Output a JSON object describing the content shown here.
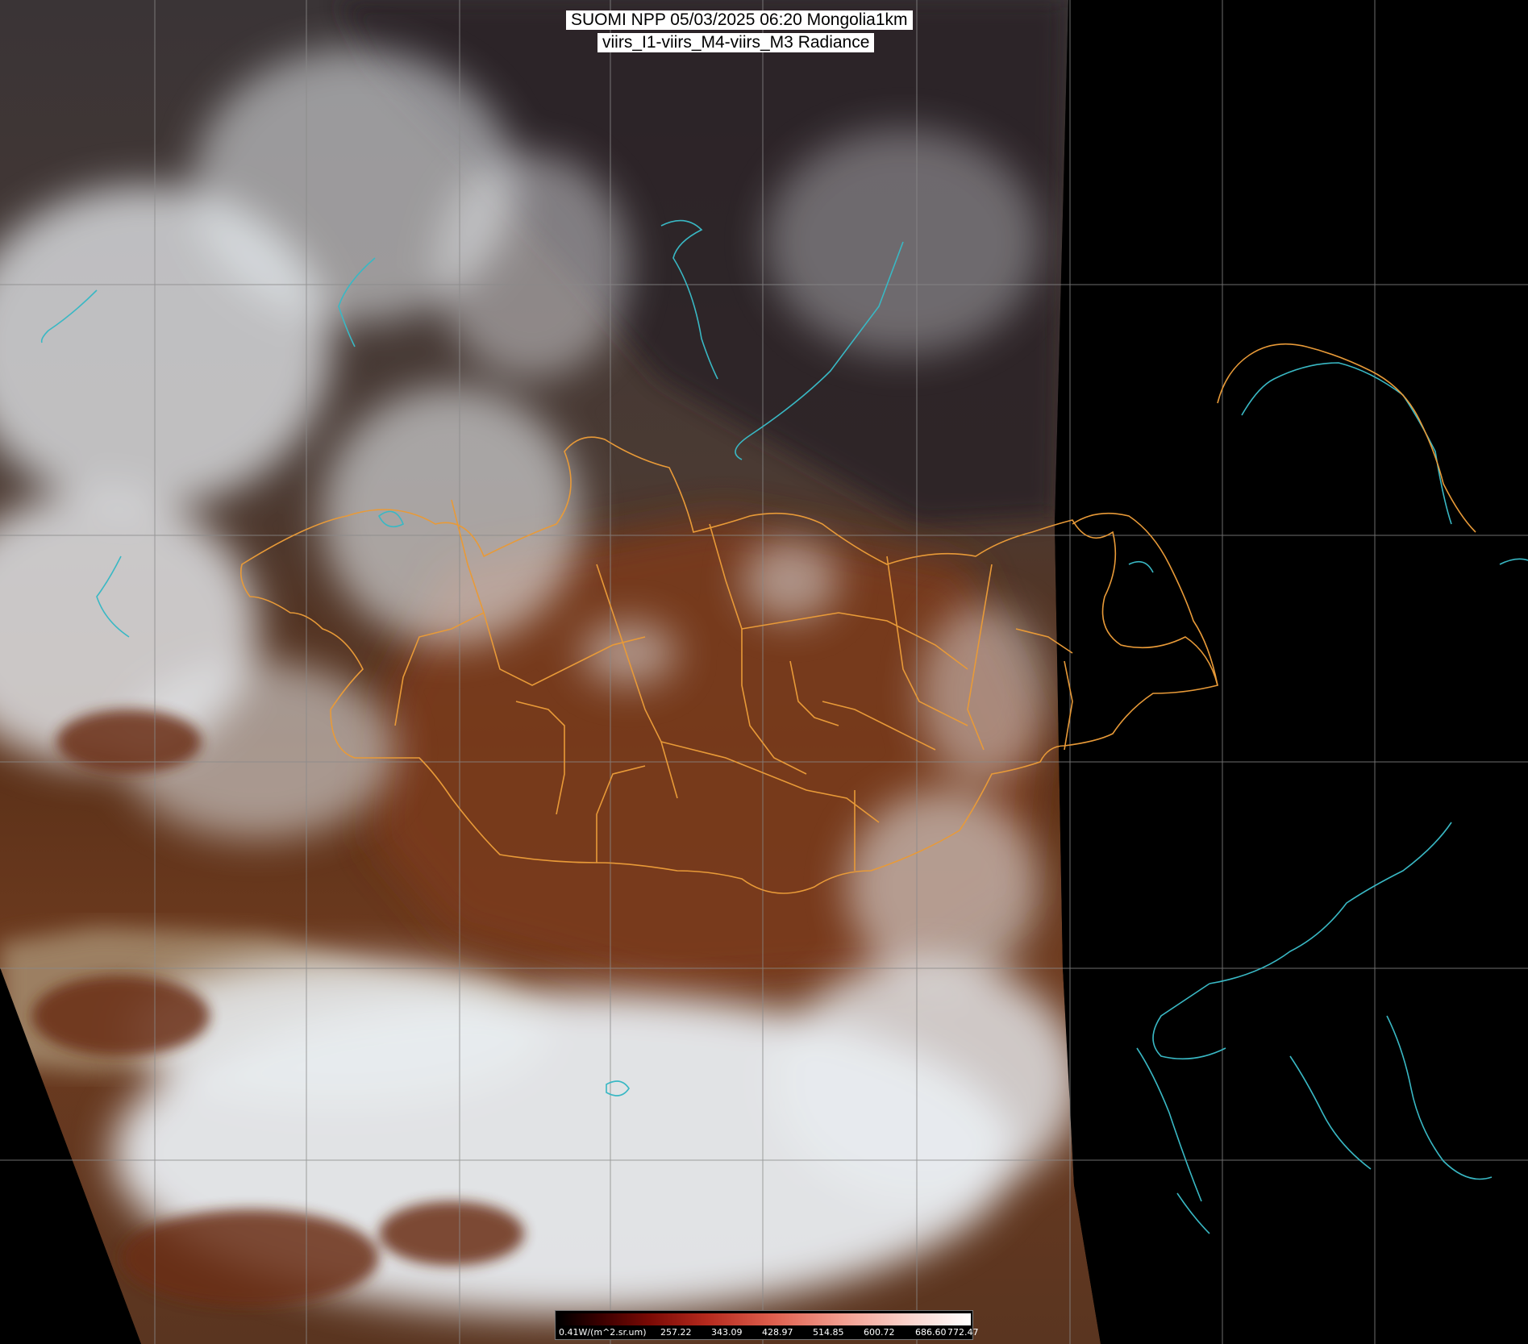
{
  "title": {
    "line1": "SUOMI NPP 05/03/2025 06:20 Mongolia1km",
    "line2": "viirs_I1-viirs_M4-viirs_M3 Radiance"
  },
  "colorbar": {
    "labels": [
      "0.41W/(m^2.sr.um)",
      "257.22",
      "343.09",
      "428.97",
      "514.85",
      "600.72",
      "686.60",
      "772.47"
    ],
    "colors": [
      "#000000",
      "#7a0a05",
      "#de5f4e",
      "#ffffff"
    ]
  },
  "map": {
    "background": "#000000",
    "grid_color": "#8a8a8a",
    "admin_border_color": "#e89a38",
    "coastline_color": "#39b8c4",
    "cloud_color": "#e8ecf0",
    "desert_color": "#7a3a1c",
    "dust_color": "#a58c6e"
  }
}
